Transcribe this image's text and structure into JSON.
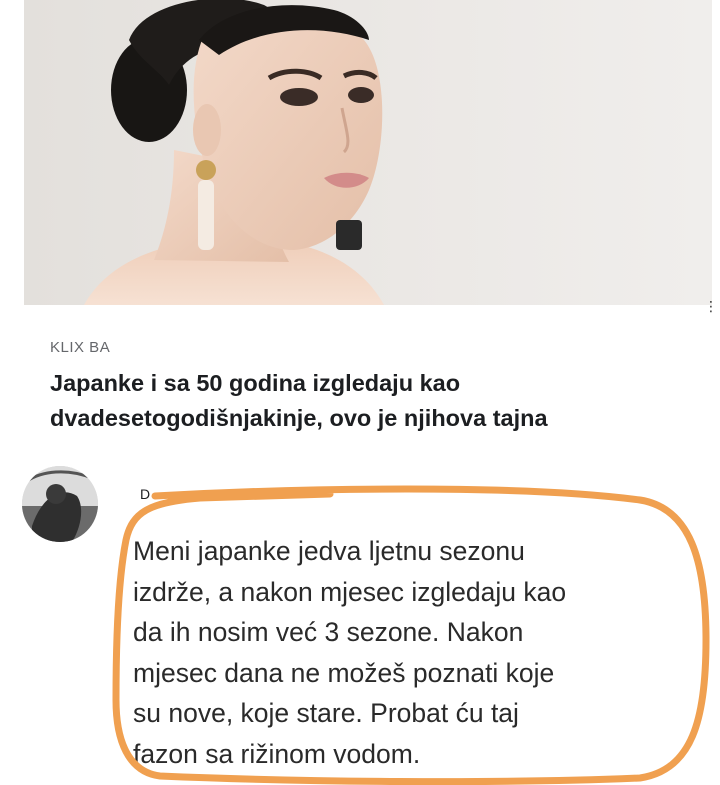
{
  "post": {
    "source": "KLIX BA",
    "headline": "Japanke i sa 50 godina izgledaju kao dvadesetogodišnjakinje, ovo je njihova tajna",
    "more_icon": "vertical-ellipsis-icon",
    "image_alt": "woman-portrait-photo"
  },
  "comment": {
    "author_initial": "D",
    "text": "Meni japanke jedva ljetnu sezonu\nizdrže, a nakon mjesec izgledaju kao\nda ih nosim već 3 sezone. Nakon\nmjesec dana ne možeš poznati koje\nsu nove, koje stare. Probat ću taj\nfazon sa rižinom vodom.",
    "highlight_color": "#f0a050"
  }
}
